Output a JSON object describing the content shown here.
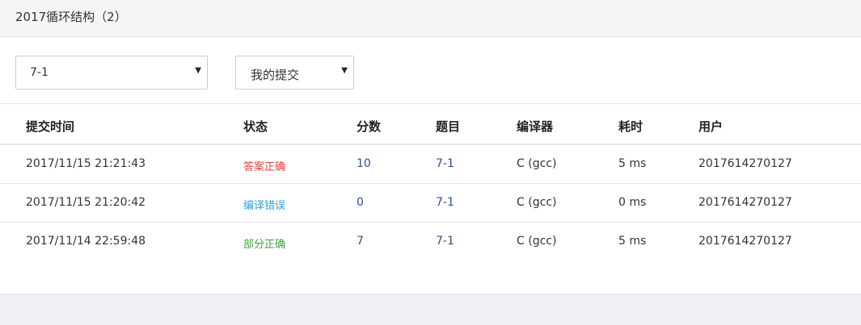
{
  "header": {
    "title": "2017循环结构（2）"
  },
  "filters": {
    "problem": "7-1",
    "scope": "我的提交"
  },
  "table": {
    "columns": [
      "提交时间",
      "状态",
      "分数",
      "题目",
      "编译器",
      "耗时",
      "用户"
    ],
    "rows": [
      {
        "time": "2017/11/15 21:21:43",
        "status": "答案正确",
        "score": "10",
        "problem": "7-1",
        "compiler": "C (gcc)",
        "elapsed": "5 ms",
        "user": "2017614270127"
      },
      {
        "time": "2017/11/15 21:20:42",
        "status": "编译错误",
        "score": "0",
        "problem": "7-1",
        "compiler": "C (gcc)",
        "elapsed": "0 ms",
        "user": "2017614270127"
      },
      {
        "time": "2017/11/14 22:59:48",
        "status": "部分正确",
        "score": "7",
        "problem": "7-1",
        "compiler": "C (gcc)",
        "elapsed": "5 ms",
        "user": "2017614270127"
      }
    ]
  },
  "colors": {
    "status_accepted": "#e0403a",
    "status_compile_error": "#2ba3d8",
    "status_partial": "#3fa143",
    "score": "#2c4f8f"
  }
}
